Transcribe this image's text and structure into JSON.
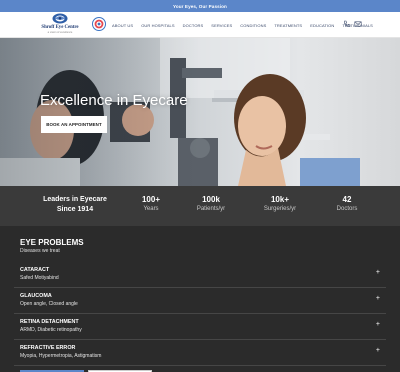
{
  "topbar": {
    "text": "Your Eyes, Our Passion"
  },
  "brand": {
    "name": "Shroff Eye Centre",
    "tagline": "a vision of excellence",
    "color": "#1f3b73"
  },
  "menu": [
    {
      "label": "ABOUT US"
    },
    {
      "label": "OUR HOSPITALS"
    },
    {
      "label": "DOCTORS"
    },
    {
      "label": "SERVICES"
    },
    {
      "label": "CONDITIONS"
    },
    {
      "label": "TREATMENTS"
    },
    {
      "label": "EDUCATION"
    },
    {
      "label": "TESTIMONIALS"
    }
  ],
  "icons": {
    "phone": "phone-icon",
    "email": "email-icon",
    "badge": "nabh-badge"
  },
  "hero": {
    "title": "Excellence in Eyecare",
    "button": "BOOK AN APPOINTMENT"
  },
  "stats": {
    "lead_line1": "Leaders in Eyecare",
    "lead_line2": "Since 1914",
    "items": [
      {
        "value": "100+",
        "label": "Years"
      },
      {
        "value": "100k",
        "label": "Patients/yr"
      },
      {
        "value": "10k+",
        "label": "Surgeries/yr"
      },
      {
        "value": "42",
        "label": "Doctors"
      }
    ]
  },
  "problems": {
    "title": "EYE PROBLEMS",
    "subtitle": "Diseases we treat",
    "items": [
      {
        "name": "CATARACT",
        "desc": "Safed Motiyabind"
      },
      {
        "name": "GLAUCOMA",
        "desc": "Open angle, Closed angle"
      },
      {
        "name": "RETINA DETACHMENT",
        "desc": "ARMD, Diabetic retinopathy"
      },
      {
        "name": "REFRACTIVE ERROR",
        "desc": "Myopia, Hypermetropia, Astigmatism"
      }
    ],
    "expand_symbol": "+"
  },
  "colors": {
    "accent": "#5b86c9",
    "dark_band": "#3a3a3a",
    "problems_bg": "#2b2b2b"
  }
}
